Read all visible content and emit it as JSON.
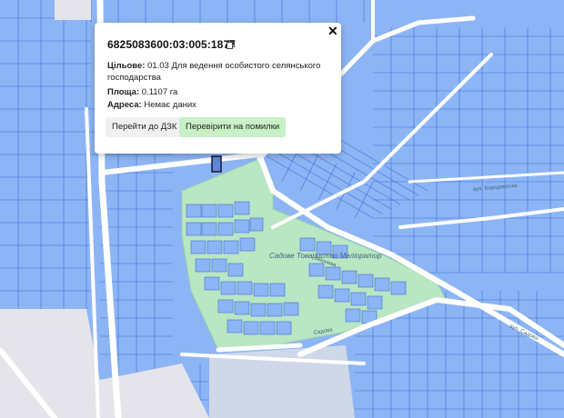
{
  "popup": {
    "cadastral_number": "6825083600:03:005:1877",
    "purpose_label": "Цільове:",
    "purpose_value": "01.03 Для ведення особистого селянського господарства",
    "area_label": "Площа:",
    "area_value": "0.1107 га",
    "address_label": "Адреса:",
    "address_value": "Немає даних",
    "button_dzk": "Перейти до ДЗК",
    "button_check": "Перевірити на помилки",
    "icons": {
      "copy": "copy-icon",
      "close": "close-icon"
    }
  },
  "map_labels": {
    "garden": "Садове Товариство Меліоратор",
    "street1": "Вишнева",
    "street2": "Садова",
    "street3": "вул. Бородянська",
    "street4": "вул. Садова"
  },
  "colors": {
    "parcel_fill": "#8db5f5",
    "parcel_stroke": "#3d6fd6",
    "green_area": "#b9e6c3",
    "road": "#ffffff",
    "background": "#e9e9ee",
    "button_check_bg": "#c9f0c6"
  }
}
